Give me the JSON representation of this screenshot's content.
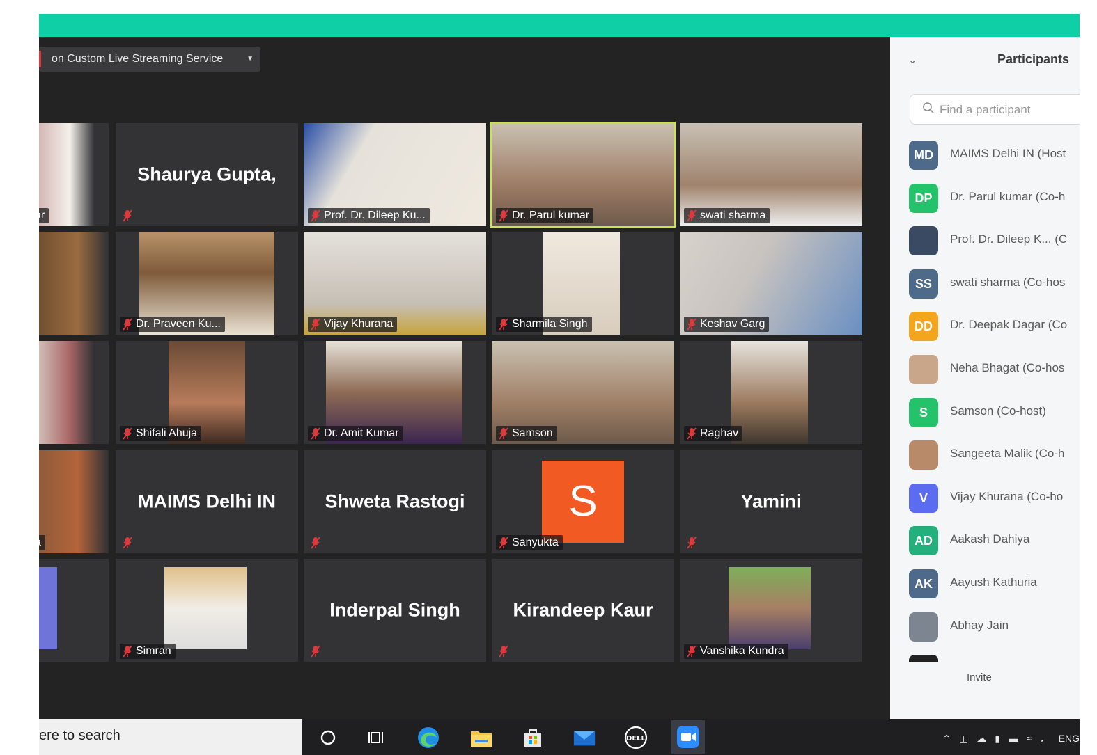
{
  "streaming": {
    "label": "on Custom Live Streaming Service"
  },
  "tiles": [
    {
      "name": "",
      "label": "ar",
      "type": "video"
    },
    {
      "name": "Shaurya Gupta,",
      "label": "",
      "type": "name"
    },
    {
      "name": "",
      "label": "Prof. Dr. Dileep Ku...",
      "type": "video"
    },
    {
      "name": "",
      "label": "Dr. Parul kumar",
      "type": "video"
    },
    {
      "name": "",
      "label": "swati sharma",
      "type": "video"
    },
    {
      "name": "",
      "label": "",
      "type": "video"
    },
    {
      "name": "",
      "label": "Dr. Praveen Ku...",
      "type": "video"
    },
    {
      "name": "",
      "label": "Vijay Khurana",
      "type": "video"
    },
    {
      "name": "",
      "label": "Sharmila Singh",
      "type": "video"
    },
    {
      "name": "",
      "label": "Keshav Garg",
      "type": "video"
    },
    {
      "name": "",
      "label": "",
      "type": "video"
    },
    {
      "name": "",
      "label": "Shifali Ahuja",
      "type": "video"
    },
    {
      "name": "",
      "label": "Dr. Amit Kumar",
      "type": "video"
    },
    {
      "name": "",
      "label": "Samson",
      "type": "video"
    },
    {
      "name": "",
      "label": "Raghav",
      "type": "video"
    },
    {
      "name": "",
      "label": "a",
      "type": "video"
    },
    {
      "name": "MAIMS Delhi IN",
      "label": "",
      "type": "name"
    },
    {
      "name": "Shweta Rastogi",
      "label": "",
      "type": "name"
    },
    {
      "name": "",
      "label": "Sanyukta",
      "type": "avatar",
      "avatar_letter": "S"
    },
    {
      "name": "Yamini",
      "label": "",
      "type": "name"
    },
    {
      "name": "",
      "label": "",
      "type": "video"
    },
    {
      "name": "",
      "label": "Simran",
      "type": "video"
    },
    {
      "name": "Inderpal Singh",
      "label": "",
      "type": "name"
    },
    {
      "name": "Kirandeep Kaur",
      "label": "",
      "type": "name"
    },
    {
      "name": "",
      "label": "Vanshika Kundra",
      "type": "video"
    }
  ],
  "panel": {
    "title": "Participants",
    "search_placeholder": "Find a participant",
    "invite_label": "Invite",
    "participants": [
      {
        "initials": "MD",
        "name": "MAIMS Delhi IN (Host",
        "color": "#4d6a8a"
      },
      {
        "initials": "DP",
        "name": "Dr. Parul kumar (Co-h",
        "color": "#23c26b"
      },
      {
        "initials": "",
        "name": "Prof. Dr. Dileep K... (C",
        "color": "#3b4a63"
      },
      {
        "initials": "SS",
        "name": "swati sharma (Co-hos",
        "color": "#4d6a8a"
      },
      {
        "initials": "DD",
        "name": "Dr. Deepak Dagar (Co",
        "color": "#f3a51d"
      },
      {
        "initials": "",
        "name": "Neha Bhagat (Co-hos",
        "color": "#c9a58a"
      },
      {
        "initials": "S",
        "name": "Samson (Co-host)",
        "color": "#23c26b"
      },
      {
        "initials": "",
        "name": "Sangeeta Malik (Co-h",
        "color": "#b98a6a"
      },
      {
        "initials": "V",
        "name": "Vijay Khurana (Co-ho",
        "color": "#5b6cf0"
      },
      {
        "initials": "AD",
        "name": "Aakash Dahiya",
        "color": "#23b07d"
      },
      {
        "initials": "AK",
        "name": "Aayush Kathuria",
        "color": "#4d6a8a"
      },
      {
        "initials": "",
        "name": "Abhay Jain",
        "color": "#7d8590"
      },
      {
        "initials": "",
        "name": "",
        "color": "#222"
      }
    ]
  },
  "taskbar": {
    "search_text": "ere to search",
    "lang": "ENG"
  },
  "colors": {
    "topbar": "#0ecfa6",
    "active_speaker": "#c8e64a",
    "avatar_orange": "#f25a23"
  }
}
